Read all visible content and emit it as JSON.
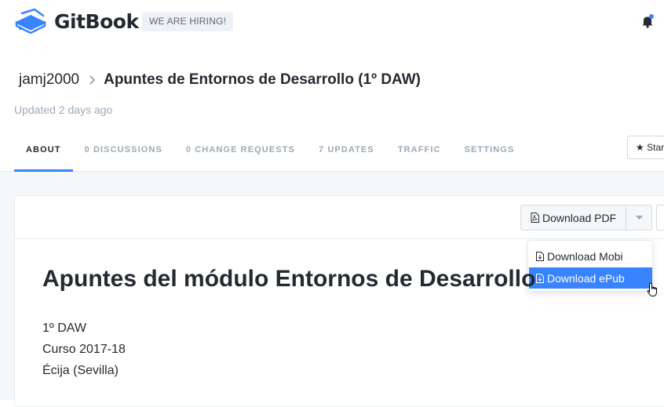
{
  "header": {
    "brand": "GitBook",
    "hiring_badge": "WE ARE HIRING!",
    "accent_color": "#3884ff"
  },
  "breadcrumb": {
    "owner": "jamj2000",
    "title": "Apuntes de Entornos de Desarrollo (1º DAW)"
  },
  "updated": "Updated 2 days ago",
  "tabs": [
    {
      "label": "ABOUT",
      "active": true
    },
    {
      "label": "0 DISCUSSIONS",
      "active": false
    },
    {
      "label": "0 CHANGE REQUESTS",
      "active": false
    },
    {
      "label": "7 UPDATES",
      "active": false
    },
    {
      "label": "TRAFFIC",
      "active": false
    },
    {
      "label": "SETTINGS",
      "active": false
    }
  ],
  "star_label": "Star",
  "download": {
    "main_label": "Download PDF",
    "menu": [
      {
        "label": "Download Mobi",
        "highlighted": false
      },
      {
        "label": "Download ePub",
        "highlighted": true
      }
    ]
  },
  "document": {
    "heading": "Apuntes del módulo Entornos de Desarrollo",
    "lines": [
      "1º DAW",
      "Curso 2017-18",
      "Écija (Sevilla)"
    ]
  },
  "icons": [
    "gitbook-logo-icon",
    "bell-icon",
    "chevron-right-icon",
    "star-icon",
    "pdf-file-icon",
    "caret-down-icon",
    "file-icon",
    "hand-cursor-icon"
  ]
}
